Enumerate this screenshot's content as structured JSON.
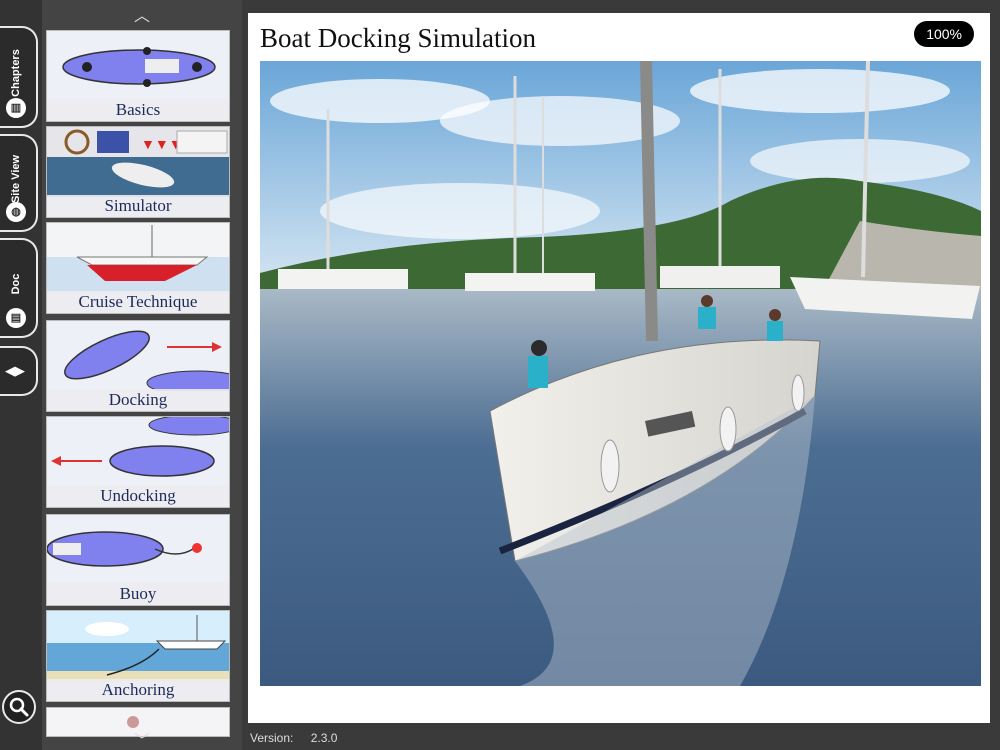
{
  "rail": {
    "tabs": [
      {
        "label": "Chapters",
        "icon": "books-icon"
      },
      {
        "label": "Site View",
        "icon": "globe-icon"
      },
      {
        "label": "Doc",
        "icon": "book-icon"
      }
    ],
    "toggle_icon": "play-toggle-icon",
    "search_icon": "search-icon"
  },
  "thumbnails": [
    {
      "caption": "Basics"
    },
    {
      "caption": "Simulator"
    },
    {
      "caption": "Cruise Technique"
    },
    {
      "caption": "Docking"
    },
    {
      "caption": "Undocking"
    },
    {
      "caption": "Buoy"
    },
    {
      "caption": "Anchoring"
    }
  ],
  "main": {
    "title": "Boat Docking Simulation",
    "zoom": "100%"
  },
  "footer": {
    "version_label": "Version:",
    "version_value": "2.3.0"
  }
}
